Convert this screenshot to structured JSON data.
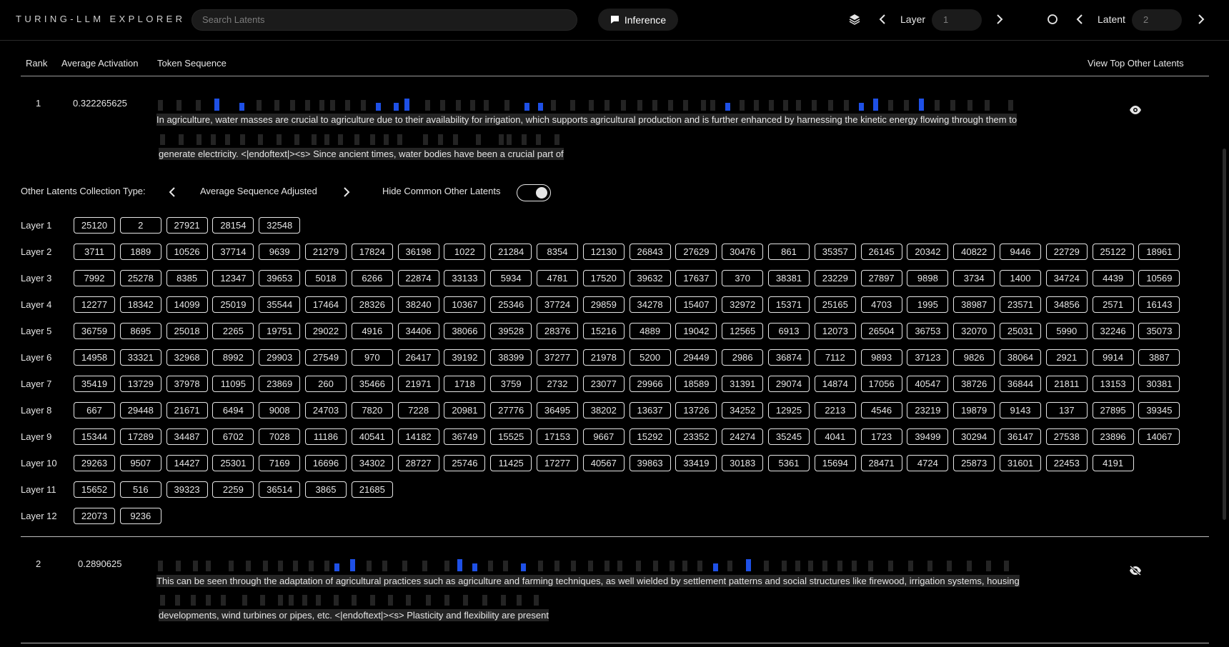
{
  "app": {
    "title": "TURING-LLM EXPLORER"
  },
  "search": {
    "placeholder": "Search Latents"
  },
  "toolbar": {
    "inference_label": "Inference",
    "layer_label": "Layer",
    "layer_value": "1",
    "latent_label": "Latent",
    "latent_value": "2"
  },
  "table": {
    "headers": {
      "rank": "Rank",
      "avg_activation": "Average Activation",
      "token_sequence": "Token Sequence",
      "view_other": "View Top Other Latents"
    }
  },
  "rows": [
    {
      "rank": "1",
      "activation": "0.322265625",
      "line1": [
        "In agriculture,",
        " water",
        " masses",
        " are",
        " crucial",
        " to",
        " agriculture",
        " due",
        " to",
        " their",
        " availability",
        " for",
        " irrigation,",
        " which",
        " supports",
        " agricultural",
        " production",
        " and",
        " is",
        " further",
        " enhanced",
        " by",
        " harnessing",
        " the",
        " kinetic",
        " energy",
        " flowing",
        " through",
        " them",
        " to"
      ],
      "line2": [
        " generate",
        " electricity.",
        " <|endoftext|><s>",
        " Since",
        " ancient",
        " times,",
        " water",
        " bodies",
        " have",
        " been",
        " a",
        " crucial",
        " part",
        " of"
      ],
      "visible": true
    },
    {
      "rank": "2",
      "activation": "0.2890625",
      "line1": [
        "This",
        " can",
        " be",
        " seen",
        " through",
        " the",
        " adaptation",
        " of",
        " agricultural",
        " practices",
        " such",
        " as",
        " agriculture",
        " and",
        " farming",
        " techniques,",
        " as",
        " well",
        " wielded",
        " by",
        " settlement",
        " patterns",
        " and",
        " social",
        " structures",
        " like",
        " firewood,",
        " irrigation",
        " systems,",
        " housing"
      ],
      "line2": [
        " developments,",
        " wind",
        " turbines",
        " or",
        " pipes,",
        " etc.",
        " <|endoftext|><s>",
        " Plasticity",
        " and",
        " flexibility",
        " are",
        " present"
      ],
      "visible": false
    }
  ],
  "collection": {
    "label": "Other Latents Collection Type:",
    "type": "Average Sequence Adjusted",
    "hide_label": "Hide Common Other Latents",
    "hide_on": true
  },
  "layers": [
    {
      "name": "Layer 1",
      "latents": [
        "25120",
        "2",
        "27921",
        "28154",
        "32548"
      ]
    },
    {
      "name": "Layer 2",
      "latents": [
        "3711",
        "1889",
        "10526",
        "37714",
        "9639",
        "21279",
        "17824",
        "36198",
        "1022",
        "21284",
        "8354",
        "12130",
        "26843",
        "27629",
        "30476",
        "861",
        "35357",
        "26145",
        "20342",
        "40822",
        "9446",
        "22729",
        "25122",
        "18961"
      ]
    },
    {
      "name": "Layer 3",
      "latents": [
        "7992",
        "25278",
        "8385",
        "12347",
        "39653",
        "5018",
        "6266",
        "22874",
        "33133",
        "5934",
        "4781",
        "17520",
        "39632",
        "17637",
        "370",
        "38381",
        "23229",
        "27897",
        "9898",
        "3734",
        "1400",
        "34724",
        "4439",
        "10569"
      ]
    },
    {
      "name": "Layer 4",
      "latents": [
        "12277",
        "18342",
        "14099",
        "25019",
        "35544",
        "17464",
        "28326",
        "38240",
        "10367",
        "25346",
        "37724",
        "29859",
        "34278",
        "15407",
        "32972",
        "15371",
        "25165",
        "4703",
        "1995",
        "38987",
        "23571",
        "34856",
        "2571",
        "16143"
      ]
    },
    {
      "name": "Layer 5",
      "latents": [
        "36759",
        "8695",
        "25018",
        "2265",
        "19751",
        "29022",
        "4916",
        "34406",
        "38066",
        "39528",
        "28376",
        "15216",
        "4889",
        "19042",
        "12565",
        "6913",
        "12073",
        "26504",
        "36753",
        "32070",
        "25031",
        "5990",
        "32246",
        "35073"
      ]
    },
    {
      "name": "Layer 6",
      "latents": [
        "14958",
        "33321",
        "32968",
        "8992",
        "29903",
        "27549",
        "970",
        "26417",
        "39192",
        "38399",
        "37277",
        "21978",
        "5200",
        "29449",
        "2986",
        "36874",
        "7112",
        "9893",
        "37123",
        "9826",
        "38064",
        "2921",
        "9914",
        "3887"
      ]
    },
    {
      "name": "Layer 7",
      "latents": [
        "35419",
        "13729",
        "37978",
        "11095",
        "23869",
        "260",
        "35466",
        "21971",
        "1718",
        "3759",
        "2732",
        "23077",
        "29966",
        "18589",
        "31391",
        "29074",
        "14874",
        "17056",
        "40547",
        "38726",
        "36844",
        "21811",
        "13153",
        "30381"
      ]
    },
    {
      "name": "Layer 8",
      "latents": [
        "667",
        "29448",
        "21671",
        "6494",
        "9008",
        "24703",
        "7820",
        "7228",
        "20981",
        "27776",
        "36495",
        "38202",
        "13637",
        "13726",
        "34252",
        "12925",
        "2213",
        "4546",
        "23219",
        "19879",
        "9143",
        "137",
        "27895",
        "39345"
      ]
    },
    {
      "name": "Layer 9",
      "latents": [
        "15344",
        "17289",
        "34487",
        "6702",
        "7028",
        "11186",
        "40541",
        "14182",
        "36749",
        "15525",
        "17153",
        "9667",
        "15292",
        "23352",
        "24274",
        "35245",
        "4041",
        "1723",
        "39499",
        "30294",
        "36147",
        "27538",
        "23896",
        "14067"
      ]
    },
    {
      "name": "Layer 10",
      "latents": [
        "29263",
        "9507",
        "14427",
        "25301",
        "7169",
        "16696",
        "34302",
        "28727",
        "25746",
        "11425",
        "17277",
        "40567",
        "39863",
        "33419",
        "30183",
        "5361",
        "15694",
        "28471",
        "4724",
        "25873",
        "31601",
        "22453",
        "4191"
      ]
    },
    {
      "name": "Layer 11",
      "latents": [
        "15652",
        "516",
        "39323",
        "2259",
        "36514",
        "3865",
        "21685"
      ]
    },
    {
      "name": "Layer 12",
      "latents": [
        "22073",
        "9236"
      ]
    }
  ],
  "colors": {
    "activation_bar": "#1e50e6",
    "token_bg": "#242424"
  }
}
